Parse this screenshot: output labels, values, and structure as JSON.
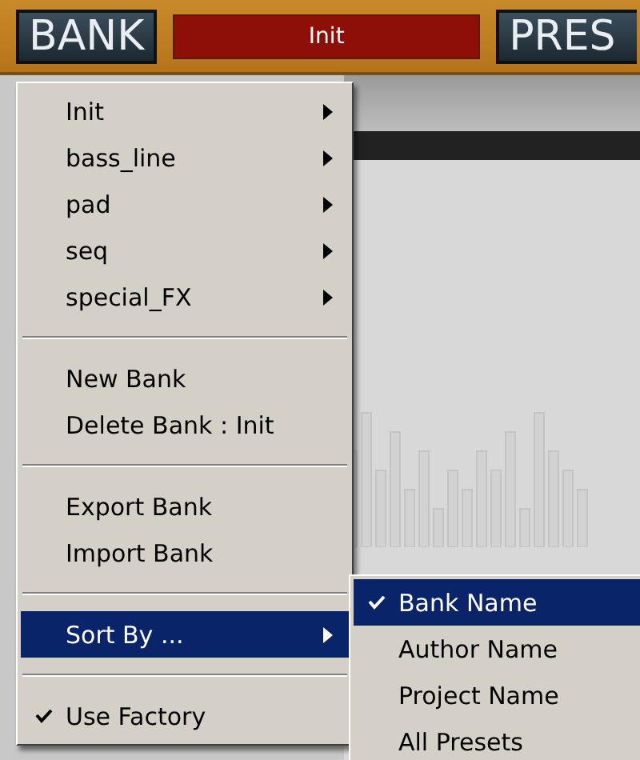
{
  "top_bar": {
    "bank_button": "BANK",
    "display": "Init",
    "preset_button": "PRES"
  },
  "menu": {
    "items": [
      {
        "kind": "submenu",
        "label": "Init",
        "selected": false
      },
      {
        "kind": "submenu",
        "label": "bass_line",
        "selected": false
      },
      {
        "kind": "submenu",
        "label": "pad",
        "selected": false
      },
      {
        "kind": "submenu",
        "label": "seq",
        "selected": false
      },
      {
        "kind": "submenu",
        "label": "special_FX",
        "selected": false
      },
      {
        "kind": "separator"
      },
      {
        "kind": "action",
        "label": "New Bank",
        "selected": false
      },
      {
        "kind": "action",
        "label": "Delete Bank : Init",
        "selected": false
      },
      {
        "kind": "separator"
      },
      {
        "kind": "action",
        "label": "Export Bank",
        "selected": false
      },
      {
        "kind": "action",
        "label": "Import Bank",
        "selected": false
      },
      {
        "kind": "separator"
      },
      {
        "kind": "submenu",
        "label": "Sort By ...",
        "selected": true
      },
      {
        "kind": "separator"
      },
      {
        "kind": "check",
        "label": "Use Factory",
        "checked": true,
        "selected": false
      }
    ]
  },
  "submenu": {
    "items": [
      {
        "label": "Bank Name",
        "checked": true,
        "selected": true
      },
      {
        "label": "Author Name",
        "checked": false,
        "selected": false
      },
      {
        "label": "Project Name",
        "checked": false,
        "selected": false
      },
      {
        "label": "All Presets",
        "checked": false,
        "selected": false
      }
    ]
  }
}
